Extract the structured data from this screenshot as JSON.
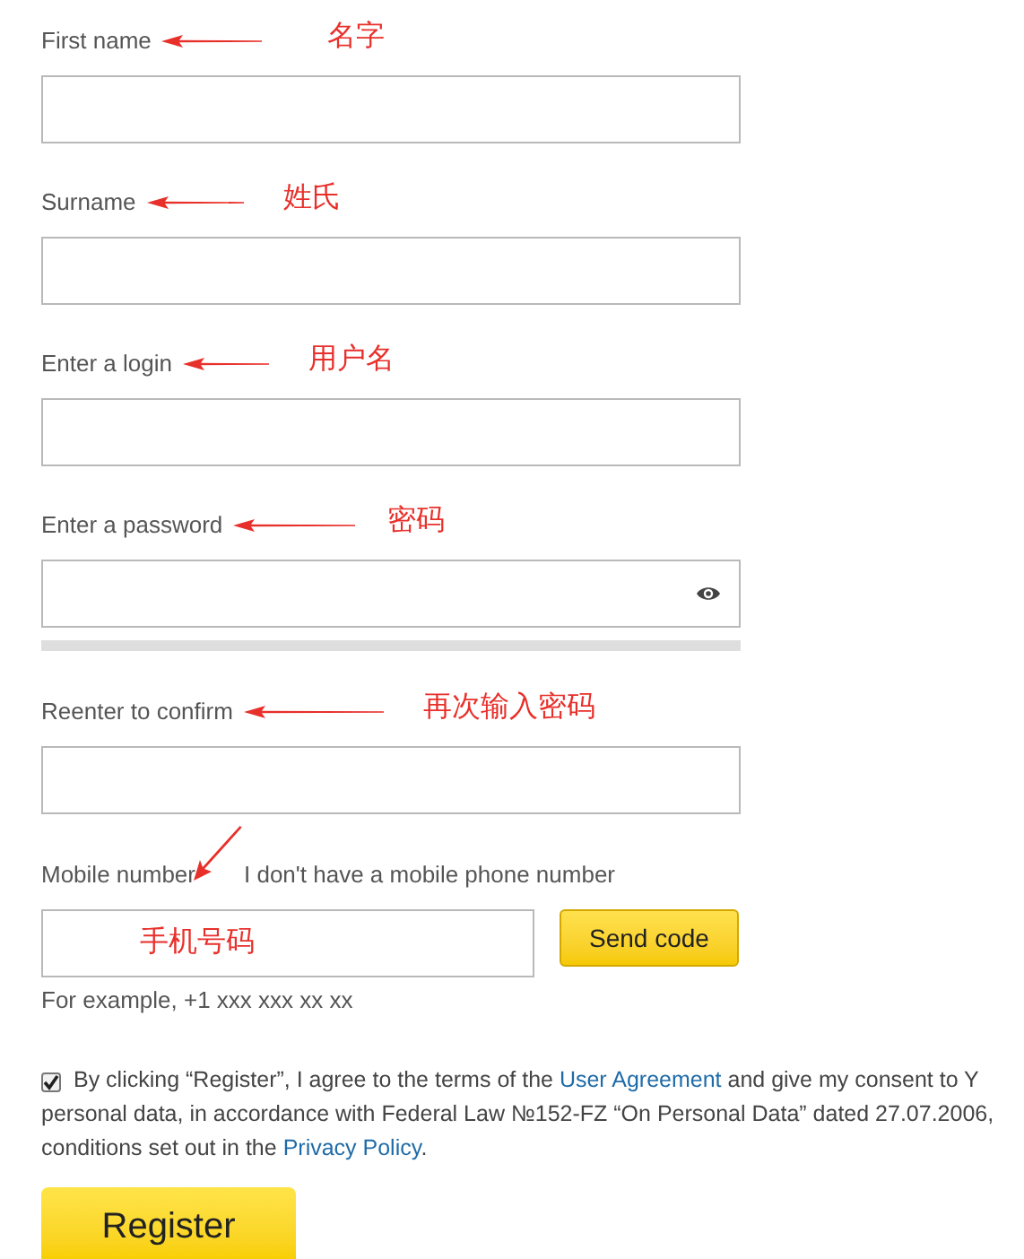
{
  "fields": [
    {
      "kind": "text",
      "label": "First name",
      "note": "名字"
    },
    {
      "kind": "text",
      "label": "Surname",
      "note": "姓氏"
    },
    {
      "kind": "text",
      "label": "Enter a login",
      "note": "用户名"
    },
    {
      "kind": "password",
      "label": "Enter a password",
      "note": "密码",
      "level": 0
    },
    {
      "kind": "text",
      "label": "Reenter to confirm",
      "note": "再次输入密码"
    }
  ],
  "mobile": {
    "label": "Mobile number",
    "no_phone_link": "I don't have a mobile phone number",
    "note": "手机号码",
    "send_button": "Send code",
    "hint": "For example, +1 xxx xxx xx xx"
  },
  "consent": {
    "checked": true,
    "lines": [
      [
        {
          "text": "By clicking “Register”, I agree to the terms of the "
        },
        {
          "text": "User Agreement",
          "link": true
        },
        {
          "text": " and give my consent to Y"
        }
      ],
      [
        {
          "text": "personal data, in accordance with Federal Law №152-FZ “On Personal Data” dated 27.07.2006,"
        }
      ],
      [
        {
          "text": "conditions set out in the "
        },
        {
          "text": "Privacy Policy",
          "link": true
        },
        {
          "text": "."
        }
      ]
    ]
  },
  "register_button": "Register"
}
